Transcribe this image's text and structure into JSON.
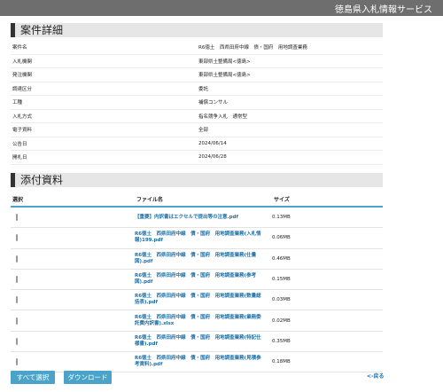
{
  "header": {
    "site_name": "徳島県入札情報サービス"
  },
  "details": {
    "title": "案件詳細",
    "rows": [
      {
        "label": "案件名",
        "value": "R6徳土　西県田府中線　債・国府　用地調査業務"
      },
      {
        "label": "入札機関",
        "value": "東部県土整備局<徳島>"
      },
      {
        "label": "発注機関",
        "value": "東部県土整備局<徳島>"
      },
      {
        "label": "調達区分",
        "value": "委託"
      },
      {
        "label": "工種",
        "value": "補償コンサル"
      },
      {
        "label": "入札方式",
        "value": "指名競争入札　通常型"
      },
      {
        "label": "電子資料",
        "value": "全部"
      },
      {
        "label": "公告日",
        "value": "2024/06/14"
      },
      {
        "label": "開札日",
        "value": "2024/06/28"
      }
    ]
  },
  "attachments": {
    "title": "添付資料",
    "columns": {
      "select": "選択",
      "filename": "ファイル名",
      "size": "サイズ"
    },
    "files": [
      {
        "name": "【重要】内訳書はエクセルで提出等の注意.pdf",
        "size": "0.13MB"
      },
      {
        "name": "R6徳土　西県田府中線　債・国府　用地調査業務(入札情報)199.pdf",
        "size": "0.06MB"
      },
      {
        "name": "R6徳土　西県田府中線　債・国府　用地調査業務(仕量図).pdf",
        "size": "0.46MB"
      },
      {
        "name": "R6徳土　西県田府中線　債・国府　用地調査業務(参考図).pdf",
        "size": "0.15MB"
      },
      {
        "name": "R6徳土　西県田府中線　債・国府　用地調査業務(数量総括表).pdf",
        "size": "0.03MB"
      },
      {
        "name": "R6徳土　西県田府中線　債・国府　用地調査業務(業務委託費内訳書).xlsx",
        "size": "0.02MB"
      },
      {
        "name": "R6徳土　西県田府中線　債・国府　用地調査業務(特記仕様書).pdf",
        "size": "0.35MB"
      },
      {
        "name": "R6徳土　西県田府中線　債・国府　用地調査業務(見積参考資料).pdf",
        "size": "0.18MB"
      }
    ]
  },
  "actions": {
    "select_all": "すべて選択",
    "download": "ダウンロード",
    "back": "<-戻る"
  },
  "colors": {
    "accent": "#4aa3c8",
    "link": "#1d6fa8",
    "topbar": "#6e6e6e"
  }
}
